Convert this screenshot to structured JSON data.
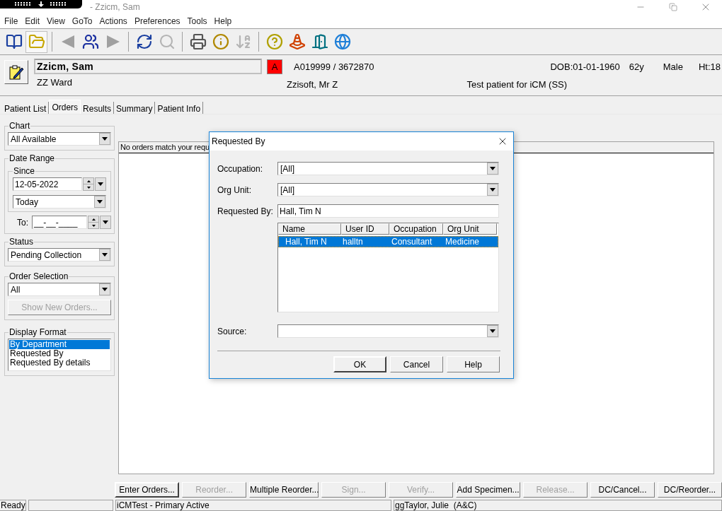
{
  "title_bar": {
    "title": "- Zzicm, Sam"
  },
  "menu": [
    "File",
    "Edit",
    "View",
    "GoTo",
    "Actions",
    "Preferences",
    "Tools",
    "Help"
  ],
  "toolbar": [
    {
      "kind": "book",
      "disabled": false,
      "pressed": false
    },
    {
      "kind": "folder",
      "disabled": false,
      "pressed": true
    },
    {
      "kind": "sep"
    },
    {
      "kind": "prev",
      "disabled": true,
      "pressed": false
    },
    {
      "kind": "people",
      "disabled": false,
      "pressed": false
    },
    {
      "kind": "next",
      "disabled": true,
      "pressed": false
    },
    {
      "kind": "sep"
    },
    {
      "kind": "refresh",
      "disabled": false,
      "pressed": false
    },
    {
      "kind": "search",
      "disabled": true,
      "pressed": false
    },
    {
      "kind": "sep"
    },
    {
      "kind": "printer",
      "disabled": false,
      "pressed": false
    },
    {
      "kind": "info",
      "disabled": false,
      "pressed": false
    },
    {
      "kind": "sort",
      "disabled": true,
      "pressed": false
    },
    {
      "kind": "sep"
    },
    {
      "kind": "help",
      "disabled": false,
      "pressed": false
    },
    {
      "kind": "traffic",
      "disabled": false,
      "pressed": false
    },
    {
      "kind": "exit",
      "disabled": false,
      "pressed": false
    },
    {
      "kind": "browser",
      "disabled": false,
      "pressed": false
    }
  ],
  "patient": {
    "name": "Zzicm, Sam",
    "ward": "ZZ Ward",
    "alert": "A",
    "ids": "A019999 / 3672870",
    "doctor": "Zzisoft, Mr Z",
    "dob": "DOB:01-01-1960",
    "age": "62y",
    "sex": "Male",
    "height": "Ht:18",
    "note": "Test patient for iCM (SS)"
  },
  "tabs": [
    {
      "label": "Patient List",
      "selected": false
    },
    {
      "label": "Orders",
      "selected": true
    },
    {
      "label": "Results",
      "selected": false
    },
    {
      "label": "Summary",
      "selected": false
    },
    {
      "label": "Patient Info",
      "selected": false
    }
  ],
  "filters": {
    "chart": {
      "label": "Chart",
      "value": "All Available"
    },
    "date_range": {
      "label": "Date Range",
      "since_label": "Since",
      "since_date": "12-05-2022",
      "since_preset": "Today",
      "to_label": "To:",
      "to_date": "__-__-____"
    },
    "status": {
      "label": "Status",
      "value": "Pending Collection"
    },
    "order_selection": {
      "label": "Order Selection",
      "value": "All",
      "button": {
        "label": "Show New Orders...",
        "disabled": true
      }
    },
    "display_format": {
      "label": "Display Format",
      "options": [
        {
          "label": "By Department",
          "selected": true
        },
        {
          "label": "Requested By",
          "selected": false
        },
        {
          "label": "Requested By details",
          "selected": false
        }
      ]
    }
  },
  "orders": {
    "message": "No orders match your requ"
  },
  "actions": [
    {
      "label": "Enter Orders...",
      "disabled": false,
      "default": true
    },
    {
      "label": "Reorder...",
      "disabled": true,
      "default": false
    },
    {
      "label": "Multiple Reorder...",
      "disabled": false,
      "default": false
    },
    {
      "label": "Sign...",
      "disabled": true,
      "default": false
    },
    {
      "label": "Verify...",
      "disabled": true,
      "default": false
    },
    {
      "label": "Add Specimen...",
      "disabled": false,
      "default": false
    },
    {
      "label": "Release...",
      "disabled": true,
      "default": false
    },
    {
      "label": "DC/Cancel...",
      "disabled": false,
      "default": false
    },
    {
      "label": "DC/Reorder...",
      "disabled": false,
      "default": false
    }
  ],
  "status_bar": {
    "state": "Ready",
    "environment": "iCMTest - Primary Active",
    "user": "ggTaylor, Julie  (A&C)"
  },
  "dialog": {
    "title": "Requested By",
    "fields": [
      {
        "kind": "select",
        "label": "Occupation:",
        "value": "[All]"
      },
      {
        "kind": "select",
        "label": "Org Unit:",
        "value": "[All]"
      },
      {
        "kind": "text",
        "label": "Requested By:",
        "value": "Hall, Tim N"
      }
    ],
    "list": {
      "columns": [
        "Name",
        "User ID",
        "Occupation",
        "Org Unit"
      ],
      "rows": [
        {
          "cells": [
            "Hall, Tim N",
            "halltn",
            "Consultant",
            "Medicine"
          ],
          "selected": true
        }
      ]
    },
    "source": {
      "kind": "select",
      "label": "Source:"
    },
    "buttons": [
      {
        "label": "OK",
        "default": true
      },
      {
        "label": "Cancel",
        "default": false
      },
      {
        "label": "Help",
        "default": false
      }
    ]
  }
}
